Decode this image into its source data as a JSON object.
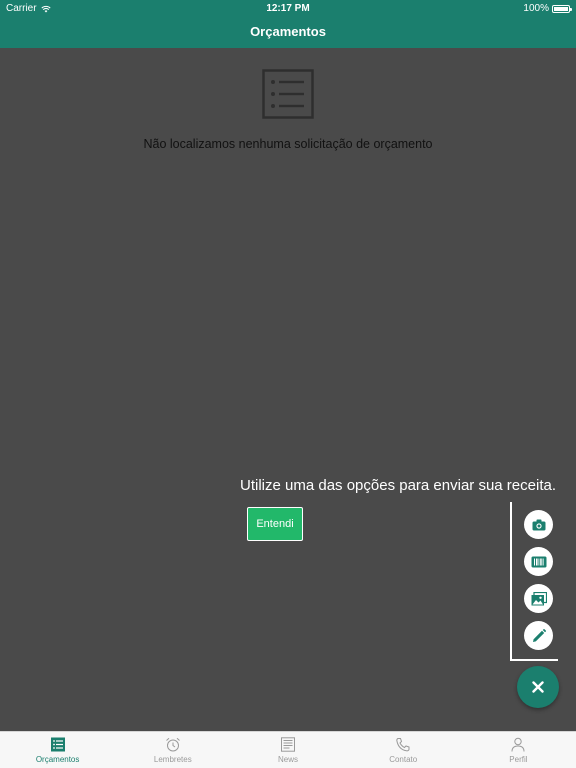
{
  "status_bar": {
    "carrier": "Carrier",
    "time": "12:17 PM",
    "battery": "100%"
  },
  "header": {
    "title": "Orçamentos"
  },
  "empty_state": {
    "message": "Não localizamos nenhuma solicitação de orçamento",
    "icon": "list-icon"
  },
  "coach_mark": {
    "text": "Utilize uma das opções para enviar sua receita.",
    "button_label": "Entendi"
  },
  "fab_menu": {
    "options": [
      {
        "icon": "camera-icon"
      },
      {
        "icon": "barcode-icon"
      },
      {
        "icon": "gallery-icon"
      },
      {
        "icon": "pencil-icon"
      }
    ],
    "main_icon": "close-icon"
  },
  "tabs": [
    {
      "label": "Orçamentos",
      "icon": "list-icon",
      "active": true
    },
    {
      "label": "Lembretes",
      "icon": "alarm-clock-icon",
      "active": false
    },
    {
      "label": "News",
      "icon": "newspaper-icon",
      "active": false
    },
    {
      "label": "Contato",
      "icon": "phone-icon",
      "active": false
    },
    {
      "label": "Perfil",
      "icon": "person-icon",
      "active": false
    }
  ],
  "colors": {
    "primary": "#1b7f6e",
    "overlay_background": "#4a4a4a",
    "accent_button": "#22b86a",
    "tab_inactive": "#9a9a9a"
  }
}
